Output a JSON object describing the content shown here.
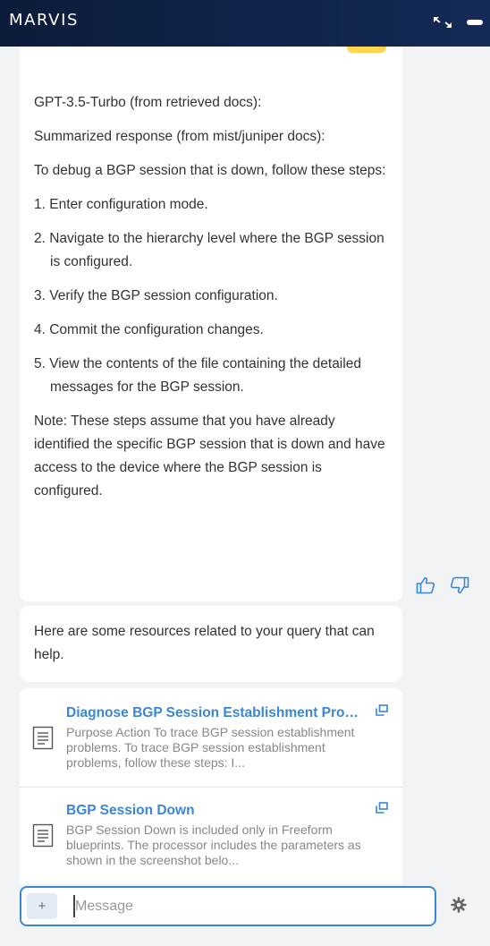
{
  "header": {
    "title": "MARVIS"
  },
  "messages": {
    "answer": {
      "intro": "GPT-3.5-Turbo (from retrieved docs):",
      "subtitle": "Summarized response (from mist/juniper docs):",
      "lead": "To debug a BGP session that is down, follow these steps:",
      "steps": [
        "1. Enter configuration mode.",
        "2. Navigate to the hierarchy level where the BGP session is configured.",
        "3. Verify the BGP session configuration.",
        "4. Commit the configuration changes.",
        "5. View the contents of the file containing the detailed messages for the BGP session."
      ],
      "note": "Note: These steps assume that you have already identified the specific BGP session that is down and have access to the device where the BGP session is configured."
    },
    "resources_intro": "Here are some resources related to your query that can help.",
    "resources": [
      {
        "title": "Diagnose BGP Session Establishment Problems",
        "desc": "Purpose Action To trace BGP session establishment problems. To trace BGP session establishment problems, follow these steps: I..."
      },
      {
        "title": "BGP Session Down",
        "desc": "BGP Session Down is included only in Freeform blueprints. The processor includes the parameters as shown in the screenshot belo..."
      }
    ]
  },
  "composer": {
    "plus_label": "+",
    "placeholder": "Message"
  },
  "colors": {
    "header_bg": "#0c1c3a",
    "accent": "#3b86d6",
    "tag": "#ffd54f"
  },
  "icons": [
    "expand-icon",
    "minimize-icon",
    "thumbs-up-icon",
    "thumbs-down-icon",
    "document-icon",
    "external-link-icon",
    "gear-icon"
  ]
}
